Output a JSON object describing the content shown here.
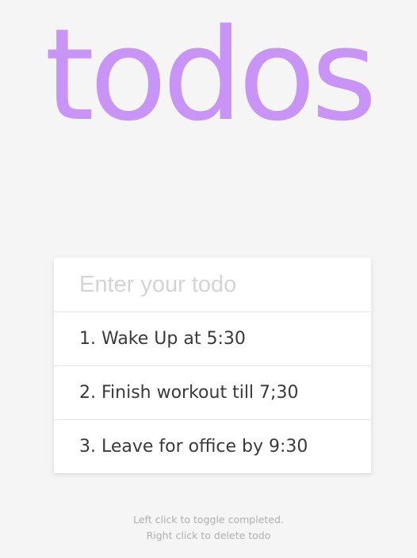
{
  "header": {
    "title": "todos"
  },
  "input": {
    "placeholder": "Enter your todo",
    "value": ""
  },
  "todos": [
    {
      "text": "1. Wake Up at 5:30",
      "completed": false
    },
    {
      "text": "2. Finish workout till 7;30",
      "completed": false
    },
    {
      "text": "3. Leave for office by 9:30",
      "completed": false
    }
  ],
  "footer": {
    "hint_toggle": "Left click to toggle completed.",
    "hint_delete": "Right click to delete todo"
  },
  "colors": {
    "title": "#c894f5",
    "background": "#f5f5f5",
    "card": "#ffffff",
    "text": "#3a3a3a",
    "hint": "#b0b0b0"
  }
}
